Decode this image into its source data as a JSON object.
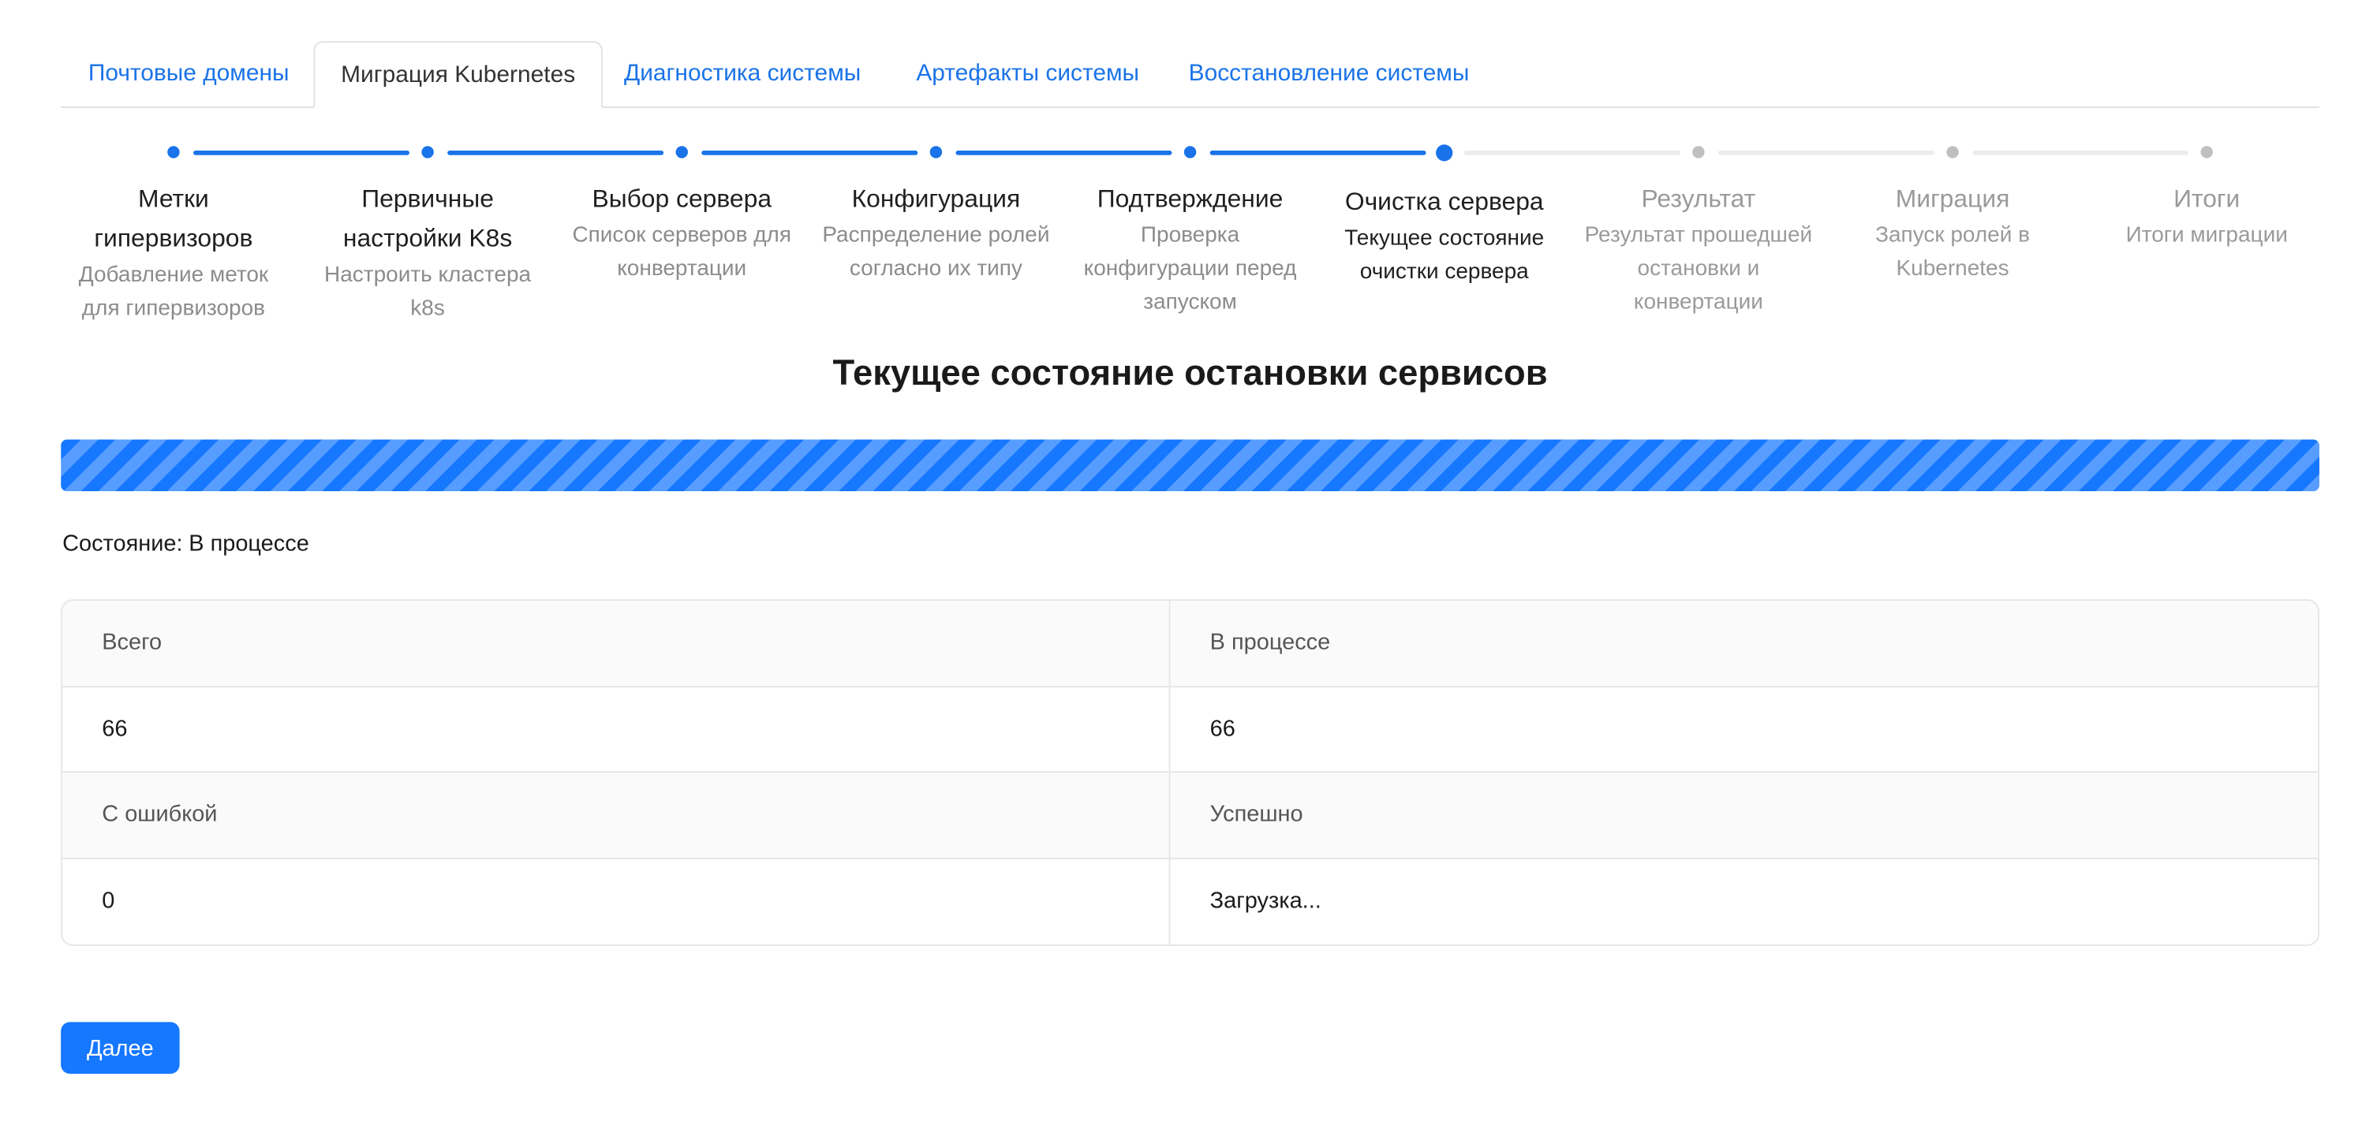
{
  "tabs": [
    {
      "label": "Почтовые домены",
      "active": false
    },
    {
      "label": "Миграция Kubernetes",
      "active": true
    },
    {
      "label": "Диагностика системы",
      "active": false
    },
    {
      "label": "Артефакты системы",
      "active": false
    },
    {
      "label": "Восстановление системы",
      "active": false
    }
  ],
  "steps": [
    {
      "title": "Метки гипервизоров",
      "desc": "Добавление меток для гипервизоров",
      "state": "done"
    },
    {
      "title": "Первичные настройки K8s",
      "desc": "Настроить кластера k8s",
      "state": "done"
    },
    {
      "title": "Выбор сервера",
      "desc": "Список серверов для конвертации",
      "state": "done"
    },
    {
      "title": "Конфигурация",
      "desc": "Распределение ролей согласно их типу",
      "state": "done"
    },
    {
      "title": "Подтверждение",
      "desc": "Проверка конфигурации перед запуском",
      "state": "done"
    },
    {
      "title": "Очистка сервера",
      "desc": "Текущее состояние очистки сервера",
      "state": "current"
    },
    {
      "title": "Результат",
      "desc": "Результат прошедшей остановки и конвертации",
      "state": "todo"
    },
    {
      "title": "Миграция",
      "desc": "Запуск ролей в Kubernetes",
      "state": "todo"
    },
    {
      "title": "Итоги",
      "desc": "Итоги миграции",
      "state": "todo"
    }
  ],
  "heading": "Текущее состояние остановки сервисов",
  "progress": {
    "percent": 100,
    "color": "#1677ff",
    "style": "striped-animated"
  },
  "status": {
    "label": "Состояние:",
    "value": "В процессе"
  },
  "stats": {
    "total_label": "Всего",
    "total_value": "66",
    "in_progress_label": "В процессе",
    "in_progress_value": "66",
    "error_label": "С ошибкой",
    "error_value": "0",
    "success_label": "Успешно",
    "success_value": "Загрузка..."
  },
  "next_button": "Далее",
  "colors": {
    "accent": "#1677ff",
    "link": "#1a73e8",
    "muted": "#8c8c8c"
  }
}
